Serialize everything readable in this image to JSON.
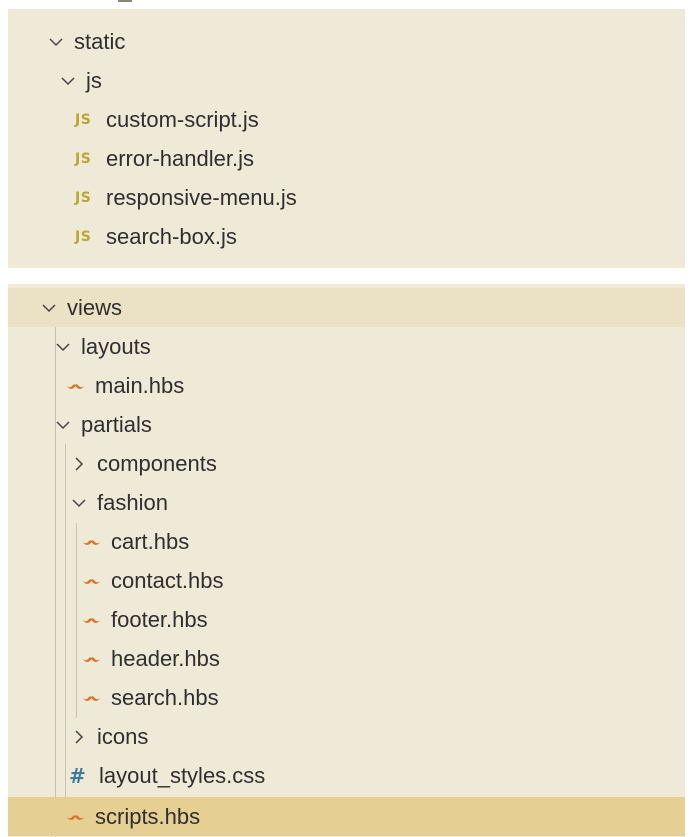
{
  "top_tree": {
    "static": "static",
    "js": "js",
    "files": [
      "custom-script.js",
      "error-handler.js",
      "responsive-menu.js",
      "search-box.js"
    ],
    "file_icon": "JS"
  },
  "bottom_tree": {
    "views": "views",
    "layouts": "layouts",
    "main": "main.hbs",
    "partials": "partials",
    "components": "components",
    "fashion": "fashion",
    "fashion_files": [
      "cart.hbs",
      "contact.hbs",
      "footer.hbs",
      "header.hbs",
      "search.hbs"
    ],
    "icons": "icons",
    "layout_styles": "layout_styles.css",
    "scripts": "scripts.hbs",
    "css_icon": "#"
  },
  "colors": {
    "panel_bg": "#efe9d8",
    "selected_bg": "#e5cf93",
    "js_icon": "#b8a732",
    "hbs_icon": "#d9722a",
    "css_icon": "#3f7c9a"
  }
}
